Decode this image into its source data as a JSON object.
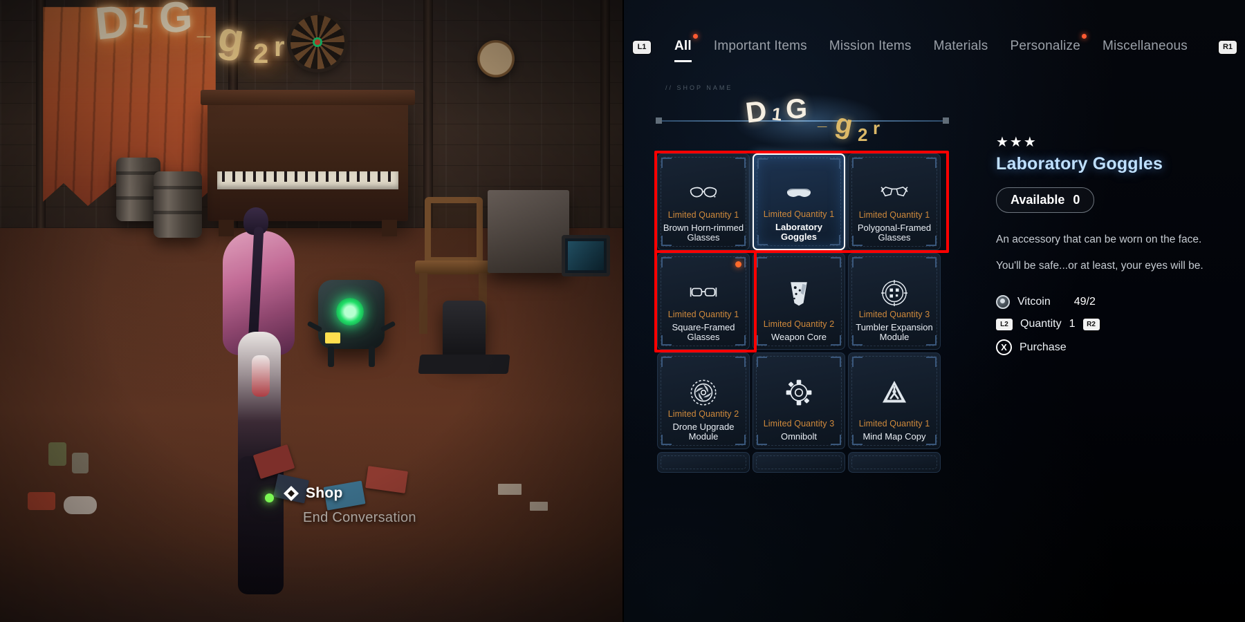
{
  "game_scene": {
    "neon_sign_letters": [
      "D",
      "1",
      "G",
      "_",
      "g",
      "2",
      "r"
    ],
    "dialogue": {
      "option_selected": "Shop",
      "option_second": "End Conversation",
      "selected_icon": "diamond-icon"
    }
  },
  "menu": {
    "bumper_left": "L1",
    "bumper_right": "R1",
    "tabs": [
      {
        "label": "All",
        "active": true,
        "notification": true
      },
      {
        "label": "Important Items",
        "active": false,
        "notification": false
      },
      {
        "label": "Mission Items",
        "active": false,
        "notification": false
      },
      {
        "label": "Materials",
        "active": false,
        "notification": false
      },
      {
        "label": "Personalize",
        "active": false,
        "notification": true
      },
      {
        "label": "Miscellaneous",
        "active": false,
        "notification": false
      }
    ],
    "shop_label": "// SHOP NAME",
    "shop_logo_letters": [
      "D",
      "1",
      "G",
      "_",
      "g",
      "2",
      "r"
    ],
    "items": [
      {
        "qty_label": "Limited Quantity",
        "qty": "1",
        "name": "Brown Horn-rimmed Glasses",
        "icon": "cat-eye-glasses-icon",
        "selected": false,
        "new_badge": false
      },
      {
        "qty_label": "Limited Quantity",
        "qty": "1",
        "name": "Laboratory Goggles",
        "icon": "safety-goggles-icon",
        "selected": true,
        "new_badge": false
      },
      {
        "qty_label": "Limited Quantity",
        "qty": "1",
        "name": "Polygonal-Framed Glasses",
        "icon": "aviator-glasses-icon",
        "selected": false,
        "new_badge": false
      },
      {
        "qty_label": "Limited Quantity",
        "qty": "1",
        "name": "Square-Framed Glasses",
        "icon": "square-glasses-icon",
        "selected": false,
        "new_badge": true
      },
      {
        "qty_label": "Limited Quantity",
        "qty": "2",
        "name": "Weapon Core",
        "icon": "weapon-core-icon",
        "selected": false,
        "new_badge": false
      },
      {
        "qty_label": "Limited Quantity",
        "qty": "3",
        "name": "Tumbler Expansion Module",
        "icon": "circuit-disc-icon",
        "selected": false,
        "new_badge": false
      },
      {
        "qty_label": "Limited Quantity",
        "qty": "2",
        "name": "Drone Upgrade Module",
        "icon": "turbine-icon",
        "selected": false,
        "new_badge": false
      },
      {
        "qty_label": "Limited Quantity",
        "qty": "3",
        "name": "Omnibolt",
        "icon": "gear-bolt-icon",
        "selected": false,
        "new_badge": false
      },
      {
        "qty_label": "Limited Quantity",
        "qty": "1",
        "name": "Mind Map Copy",
        "icon": "tri-module-icon",
        "selected": false,
        "new_badge": false
      }
    ],
    "detail": {
      "stars": "★★★",
      "title": "Laboratory Goggles",
      "available_label": "Available",
      "available_count": "0",
      "description_line1": "An accessory that can be worn on the face.",
      "description_line2": "You'll be safe...or at least, your eyes will be.",
      "currency_label": "Vitcoin",
      "currency_value": "49/2",
      "quantity_label": "Quantity",
      "quantity_value": "1",
      "quantity_dec_button": "L2",
      "quantity_inc_button": "R2",
      "purchase_label": "Purchase",
      "purchase_button": "X"
    }
  },
  "colors": {
    "accent_orange": "#d08a3c",
    "notification": "#ff5a32",
    "highlight_red": "#ff0000",
    "title_blue": "#bfe0ff",
    "selected_border": "#ffffff"
  }
}
